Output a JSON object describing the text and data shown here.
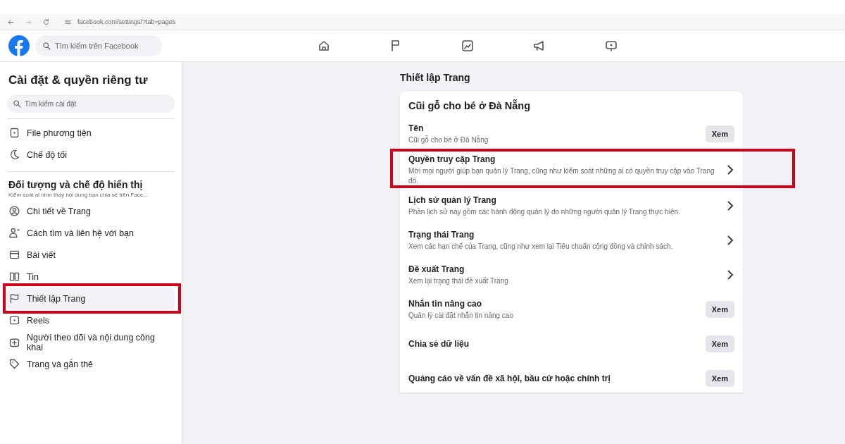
{
  "browser": {
    "url": "facebook.com/settings/?tab=pages"
  },
  "header": {
    "search_placeholder": "Tìm kiếm trên Facebook"
  },
  "sidebar": {
    "title": "Cài đặt & quyền riêng tư",
    "search_placeholder": "Tìm kiếm cài đặt",
    "top_items": [
      {
        "label": "File phương tiện",
        "selected": false,
        "highlighted": false
      },
      {
        "label": "Chế độ tối",
        "selected": false,
        "highlighted": false
      }
    ],
    "section": {
      "title": "Đối tượng và chế độ hiển thị",
      "subtitle": "Kiểm soát ai nhìn thấy nội dung bạn chia sẻ trên Face..."
    },
    "items": [
      {
        "label": "Chi tiết về Trang",
        "selected": false,
        "highlighted": false
      },
      {
        "label": "Cách tìm và liên hệ với bạn",
        "selected": false,
        "highlighted": false
      },
      {
        "label": "Bài viết",
        "selected": false,
        "highlighted": false
      },
      {
        "label": "Tin",
        "selected": false,
        "highlighted": false
      },
      {
        "label": "Thiết lập Trang",
        "selected": true,
        "highlighted": true
      },
      {
        "label": "Reels",
        "selected": false,
        "highlighted": false
      },
      {
        "label": "Người theo dõi và nội dung công khai",
        "selected": false,
        "highlighted": false
      },
      {
        "label": "Trang và gắn thẻ",
        "selected": false,
        "highlighted": false
      }
    ]
  },
  "main": {
    "title": "Thiết lập Trang",
    "card_title": "Cũi gỗ cho bé ở Đà Nẵng",
    "rows": [
      {
        "kind": "button",
        "title": "Tên",
        "description": "Cũi gỗ cho bé ở Đà Nẵng",
        "button": "Xem",
        "highlighted": false
      },
      {
        "kind": "chevron",
        "title": "Quyền truy cập Trang",
        "description": "Mời mọi người giúp bạn quản lý Trang, cũng như kiểm soát những ai có quyền truy cập vào Trang đó.",
        "highlighted": true
      },
      {
        "kind": "chevron",
        "title": "Lịch sử quản lý Trang",
        "description": "Phần lịch sử này gồm các hành động quản lý do những người quản lý Trang thực hiện.",
        "highlighted": false
      },
      {
        "kind": "chevron",
        "title": "Trạng thái Trang",
        "description": "Xem các hạn chế của Trang, cũng như xem lại Tiêu chuẩn cộng đồng và chính sách.",
        "highlighted": false
      },
      {
        "kind": "chevron",
        "title": "Đề xuất Trang",
        "description": "Xem lại trạng thái đề xuất Trang",
        "highlighted": false
      },
      {
        "kind": "button",
        "title": "Nhắn tin nâng cao",
        "description": "Quản lý cài đặt nhắn tin nâng cao",
        "button": "Xem",
        "highlighted": false
      },
      {
        "kind": "button",
        "title": "Chia sẻ dữ liệu",
        "button": "Xem",
        "highlighted": false
      },
      {
        "kind": "button",
        "title": "Quảng cáo về vấn đề xã hội, bầu cử hoặc chính trị",
        "button": "Xem",
        "highlighted": false
      }
    ]
  }
}
